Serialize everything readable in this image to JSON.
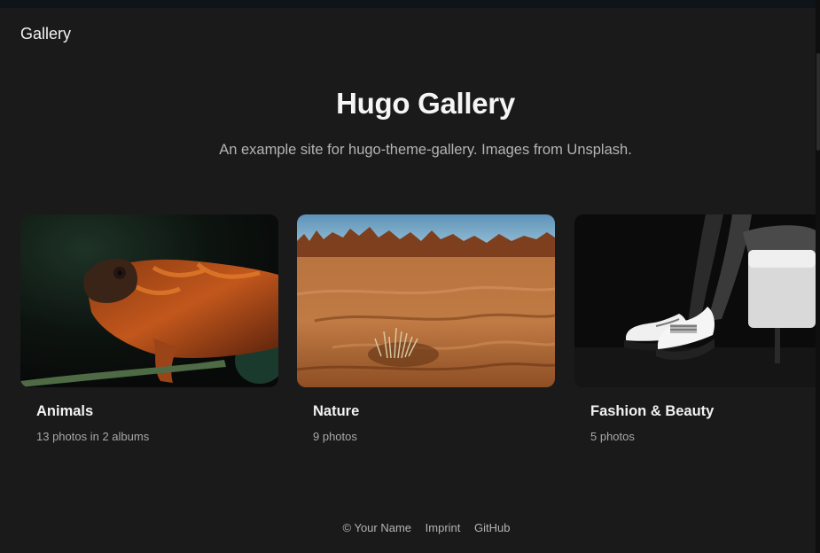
{
  "header": {
    "brand": "Gallery"
  },
  "hero": {
    "title": "Hugo Gallery",
    "subtitle": "An example site for hugo-theme-gallery. Images from Unsplash."
  },
  "albums": [
    {
      "title": "Animals",
      "meta": "13 photos in 2 albums",
      "image": "chameleon"
    },
    {
      "title": "Nature",
      "meta": "9 photos",
      "image": "desert"
    },
    {
      "title": "Fashion & Beauty",
      "meta": "5 photos",
      "image": "white-shoes"
    }
  ],
  "footer": {
    "copyright": "© Your Name",
    "imprint": "Imprint",
    "github": "GitHub"
  }
}
